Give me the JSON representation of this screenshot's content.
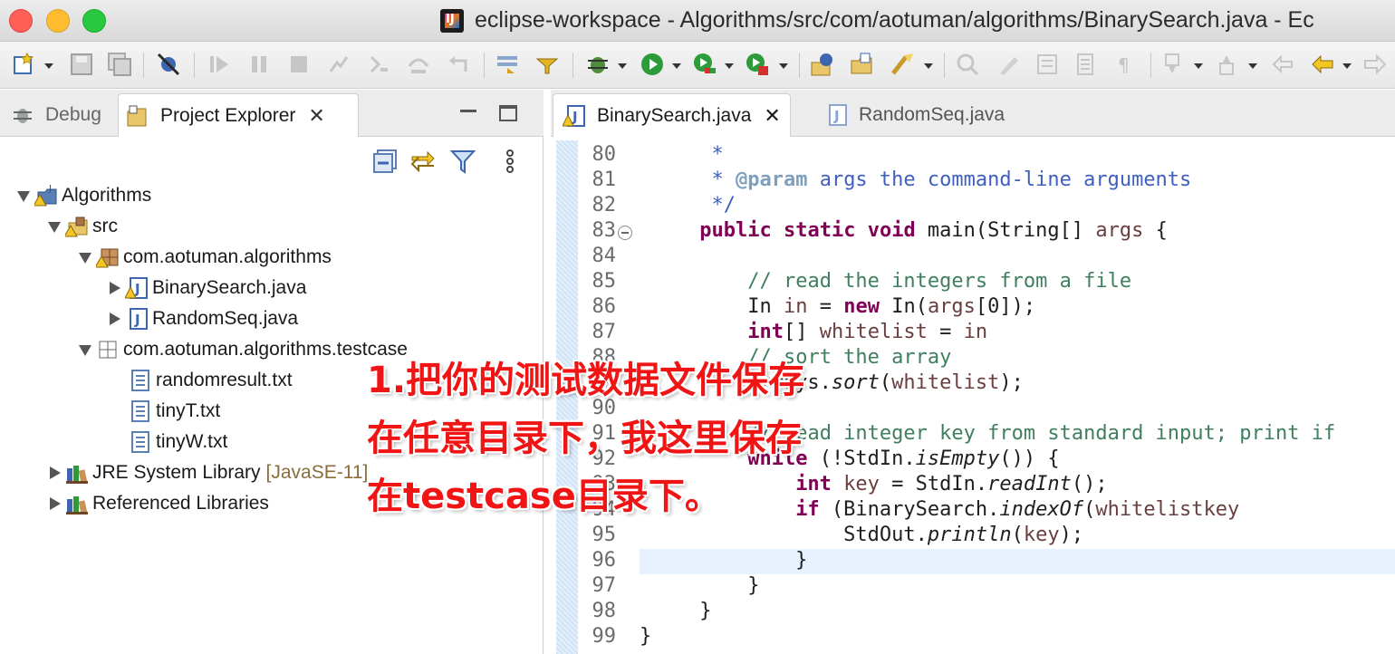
{
  "window": {
    "title": "eclipse-workspace - Algorithms/src/com/aotuman/algorithms/BinarySearch.java - Ec"
  },
  "toolbar": {
    "icons": [
      "new-icon",
      "save-icon",
      "save-all-icon",
      "skip-breakpoints-icon",
      "resume-icon",
      "suspend-icon",
      "terminate-icon",
      "disconnect-icon",
      "step-into-icon",
      "step-over-icon",
      "step-return-icon",
      "drop-to-frame-icon",
      "use-step-filters-icon",
      "debug-icon",
      "run-icon",
      "coverage-icon",
      "external-tools-icon",
      "new-java-package-icon",
      "open-type-icon",
      "search-icon",
      "toggle-mark-occurrences-icon",
      "toggle-block-selection-icon",
      "show-whitespace-icon",
      "next-annotation-icon",
      "previous-annotation-icon",
      "last-edit-location-icon",
      "back-icon",
      "forward-icon"
    ]
  },
  "left_panel": {
    "tabs": [
      {
        "label": "Debug"
      },
      {
        "label": "Project Explorer"
      }
    ],
    "tree": [
      {
        "label": "Algorithms"
      },
      {
        "label": "src"
      },
      {
        "label": "com.aotuman.algorithms"
      },
      {
        "label": "BinarySearch.java"
      },
      {
        "label": "RandomSeq.java"
      },
      {
        "label": "com.aotuman.algorithms.testcase"
      },
      {
        "label": "randomresult.txt"
      },
      {
        "label": "tinyT.txt"
      },
      {
        "label": "tinyW.txt"
      },
      {
        "label": "JRE System Library",
        "suffix": "[JavaSE-11]"
      },
      {
        "label": "Referenced Libraries"
      }
    ]
  },
  "editor": {
    "tabs": [
      {
        "label": "BinarySearch.java"
      },
      {
        "label": "RandomSeq.java"
      }
    ],
    "line_numbers": [
      "80",
      "81",
      "82",
      "83",
      "84",
      "85",
      "86",
      "87",
      "88",
      "89",
      "90",
      "91",
      "92",
      "93",
      "94",
      "95",
      "96",
      "97",
      "98",
      "99"
    ]
  },
  "annotation": {
    "lines": [
      "1.把你的测试数据文件保存",
      "在任意目录下，我这里保存",
      "在testcase目录下。"
    ]
  }
}
